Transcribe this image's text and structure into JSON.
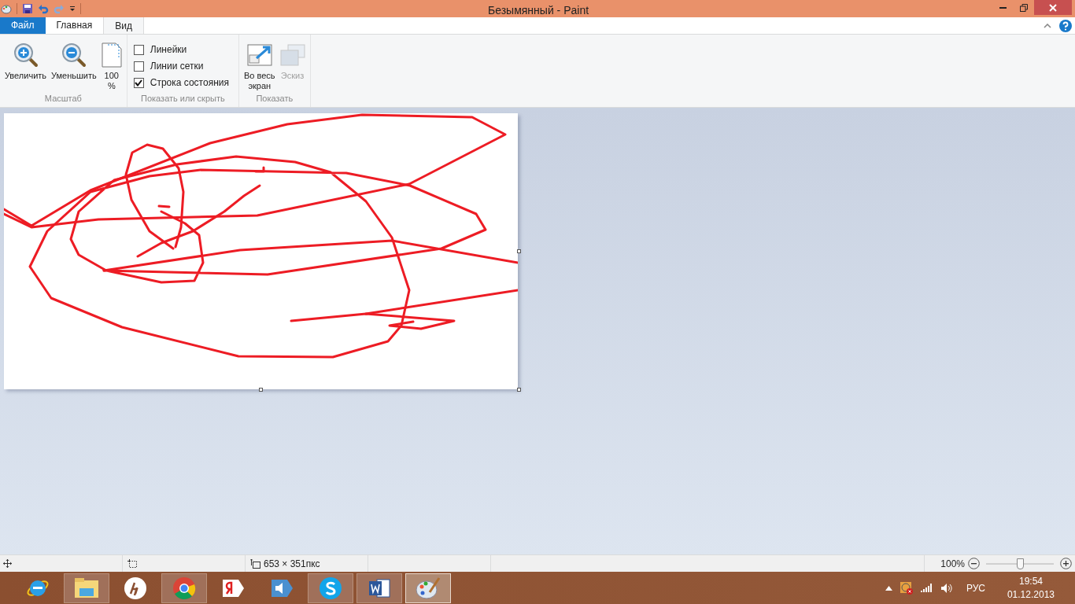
{
  "window": {
    "title": "Безымянный - Paint"
  },
  "tabs": [
    {
      "label": "Файл",
      "kind": "file",
      "selected": false
    },
    {
      "label": "Главная",
      "kind": "tab",
      "selected": false
    },
    {
      "label": "Вид",
      "kind": "tab",
      "selected": true
    }
  ],
  "ribbon": {
    "groups": [
      {
        "title": "Масштаб",
        "items": [
          {
            "kind": "zoom_in",
            "label": "Увеличить"
          },
          {
            "kind": "zoom_out",
            "label": "Уменьшить"
          },
          {
            "kind": "actual_size",
            "label": "100\n%"
          }
        ]
      },
      {
        "title": "Показать или скрыть",
        "items": [
          {
            "kind": "checkbox",
            "label": "Линейки",
            "checked": false
          },
          {
            "kind": "checkbox",
            "label": "Линии сетки",
            "checked": false
          },
          {
            "kind": "checkbox",
            "label": "Строка состояния",
            "checked": true
          }
        ]
      },
      {
        "title": "Показать",
        "items": [
          {
            "kind": "fullscreen",
            "label": "Во весь\nэкран",
            "disabled": false
          },
          {
            "kind": "thumbnail",
            "label": "Эскиз",
            "disabled": true
          }
        ]
      }
    ]
  },
  "status_bar": {
    "dimensions": "653 × 351пкс",
    "zoom": "100%",
    "zoom_slider": {
      "level": 0.5
    }
  },
  "taskbar": {
    "apps": [
      {
        "kind": "ie",
        "running": false,
        "selected": false
      },
      {
        "kind": "explorer",
        "running": true,
        "selected": false
      },
      {
        "kind": "hp",
        "running": false,
        "selected": false
      },
      {
        "kind": "chrome",
        "running": true,
        "selected": false
      },
      {
        "kind": "yandex",
        "running": false,
        "selected": false
      },
      {
        "kind": "sound",
        "running": false,
        "selected": false
      },
      {
        "kind": "skype",
        "running": true,
        "selected": false
      },
      {
        "kind": "word",
        "running": true,
        "selected": false
      },
      {
        "kind": "paint",
        "running": true,
        "selected": true
      }
    ],
    "language": "РУС",
    "time": "19:54",
    "date": "01.12.2013"
  }
}
